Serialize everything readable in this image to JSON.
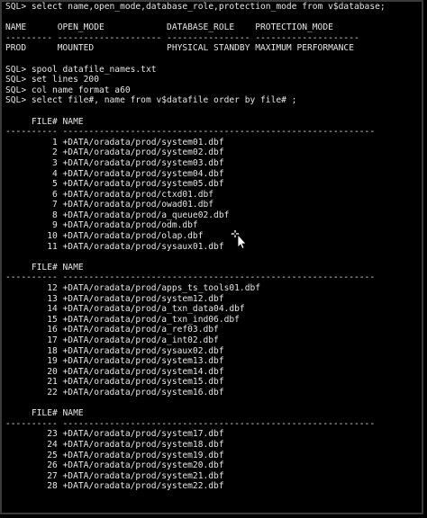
{
  "terminal": {
    "lines": [
      "SQL> select name,open_mode,database_role,protection_mode from v$database;",
      "",
      "NAME      OPEN_MODE            DATABASE_ROLE    PROTECTION_MODE",
      "--------- -------------------- ---------------- --------------------",
      "PROD      MOUNTED              PHYSICAL STANDBY MAXIMUM PERFORMANCE",
      "",
      "SQL> spool datafile_names.txt",
      "SQL> set lines 200",
      "SQL> col name format a60",
      "SQL> select file#, name from v$datafile order by file# ;",
      "",
      "     FILE# NAME",
      "---------- ------------------------------------------------------------",
      "         1 +DATA/oradata/prod/system01.dbf",
      "         2 +DATA/oradata/prod/system02.dbf",
      "         3 +DATA/oradata/prod/system03.dbf",
      "         4 +DATA/oradata/prod/system04.dbf",
      "         5 +DATA/oradata/prod/system05.dbf",
      "         6 +DATA/oradata/prod/ctxd01.dbf",
      "         7 +DATA/oradata/prod/owad01.dbf",
      "         8 +DATA/oradata/prod/a_queue02.dbf",
      "         9 +DATA/oradata/prod/odm.dbf",
      "        10 +DATA/oradata/prod/olap.dbf",
      "        11 +DATA/oradata/prod/sysaux01.dbf",
      "",
      "     FILE# NAME",
      "---------- ------------------------------------------------------------",
      "        12 +DATA/oradata/prod/apps_ts_tools01.dbf",
      "        13 +DATA/oradata/prod/system12.dbf",
      "        14 +DATA/oradata/prod/a_txn_data04.dbf",
      "        15 +DATA/oradata/prod/a_txn_ind06.dbf",
      "        16 +DATA/oradata/prod/a_ref03.dbf",
      "        17 +DATA/oradata/prod/a_int02.dbf",
      "        18 +DATA/oradata/prod/sysaux02.dbf",
      "        19 +DATA/oradata/prod/system13.dbf",
      "        20 +DATA/oradata/prod/system14.dbf",
      "        21 +DATA/oradata/prod/system15.dbf",
      "        22 +DATA/oradata/prod/system16.dbf",
      "",
      "     FILE# NAME",
      "---------- ------------------------------------------------------------",
      "        23 +DATA/oradata/prod/system17.dbf",
      "        24 +DATA/oradata/prod/system18.dbf",
      "        25 +DATA/oradata/prod/system19.dbf",
      "        26 +DATA/oradata/prod/system20.dbf",
      "        27 +DATA/oradata/prod/system21.dbf",
      "        28 +DATA/oradata/prod/system22.dbf"
    ]
  },
  "colors": {
    "background": "#000000",
    "text": "#e6e6e6",
    "border": "#3a3a3a"
  },
  "cursor_icon": "move-cursor-icon"
}
